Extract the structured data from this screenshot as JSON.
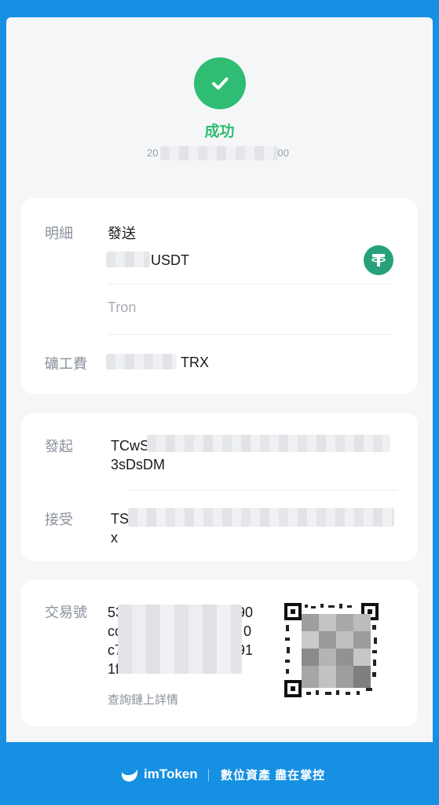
{
  "status": {
    "text": "成功",
    "timestamp_prefix": "20",
    "timestamp_suffix": "00"
  },
  "details": {
    "label": "明細",
    "action": "發送",
    "amount_unit": "USDT",
    "network": "Tron",
    "fee_label": "礦工費",
    "fee_unit": "TRX",
    "token_icon": "tether-icon"
  },
  "parties": {
    "from_label": "發起",
    "from_prefix": "TCwS",
    "from_suffix": "3sDsDM",
    "to_label": "接受",
    "to_prefix": "TS",
    "to_suffix": "x"
  },
  "tx": {
    "label": "交易號",
    "line1_start": "53",
    "line1_end": "90",
    "line2_start": "co",
    "line2_end": "0",
    "line3_start": "c7",
    "line3_end": "91",
    "line4_start": "1f",
    "explorer_link": "查詢鏈上詳情"
  },
  "footer": {
    "brand": "imToken",
    "slogan": "數位資產 盡在掌控"
  },
  "colors": {
    "success": "#2ebd72",
    "tether": "#26a17b",
    "footer": "#1590e2"
  }
}
